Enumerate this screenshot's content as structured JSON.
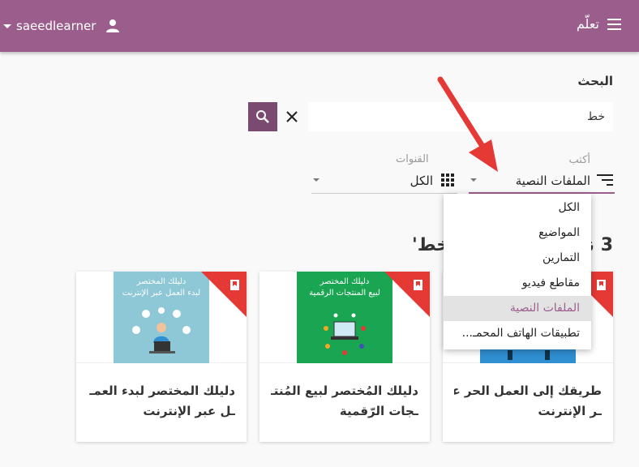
{
  "header": {
    "username": "saeedlearner",
    "brand": "تعلّم",
    "bg_color": "#9b5e8c"
  },
  "search": {
    "title": "البحث",
    "query": "خط",
    "search_icon": "search-icon",
    "clear_icon": "close-icon"
  },
  "filters": {
    "type_label": "أكتب",
    "type_value": "الملفات النصية",
    "channel_label": "القنوات",
    "channel_value": "الكل"
  },
  "menu": {
    "items": [
      {
        "label": "الكل"
      },
      {
        "label": "المواضيع"
      },
      {
        "label": "التمارين"
      },
      {
        "label": "مقاطع فيديو"
      },
      {
        "label": "الملفات النصية",
        "active": true
      },
      {
        "label": "تطبيقات الهاتف المحمـ..."
      }
    ]
  },
  "results": {
    "title_visible": "3 نـ",
    "title_tail": "خط'"
  },
  "cards": [
    {
      "title_line1": "طريقك إلى العمل الحر عبـ",
      "title_line2": "ـر الإنترنت",
      "thumb_color": "#2f8fd1"
    },
    {
      "title_line1": "دليلك المُختصر لبيع المُنتـ",
      "title_line2": "ـجات الرّقمية",
      "thumb_line1": "دليلك المختصر",
      "thumb_line2": "لبيع المنتجات الرقمية",
      "thumb_color": "#1aa552"
    },
    {
      "title_line1": "دليلك المختصر لبدء العمـ",
      "title_line2": "ـل عبر الإنترنت",
      "thumb_line1": "دليلك المختصر",
      "thumb_line2": "لبدء العمل عبر الإنترنت",
      "thumb_color": "#8ec7d6"
    }
  ],
  "accent_red": "#e53935"
}
